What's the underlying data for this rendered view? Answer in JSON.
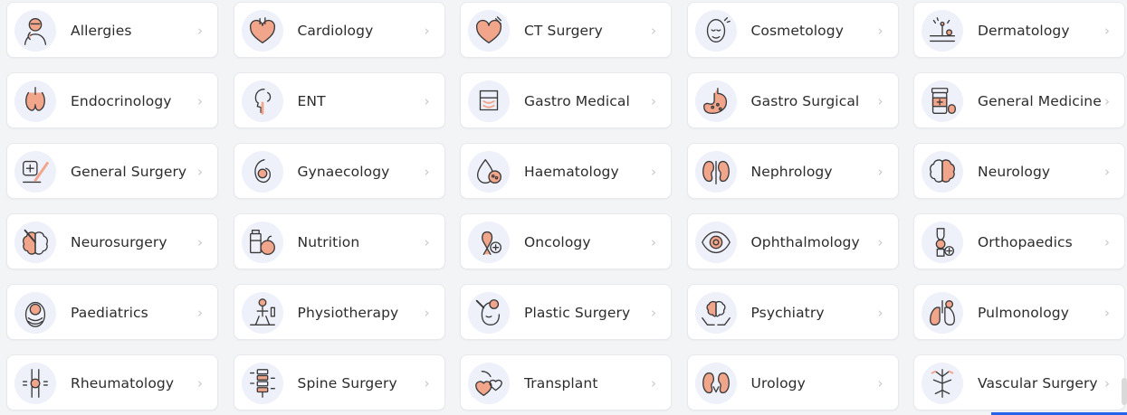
{
  "colors": {
    "icon_bg": "#eef0fa",
    "icon_stroke": "#3a3a3a",
    "icon_accent": "#f1a58b",
    "chevron": "#c4c7cf"
  },
  "chevron_glyph": "›",
  "specialties": [
    {
      "label": "Allergies",
      "icon": "allergy-person-icon"
    },
    {
      "label": "Cardiology",
      "icon": "heart-icon"
    },
    {
      "label": "CT Surgery",
      "icon": "heart-surgery-icon"
    },
    {
      "label": "Cosmetology",
      "icon": "face-care-icon"
    },
    {
      "label": "Dermatology",
      "icon": "skin-hair-icon"
    },
    {
      "label": "Endocrinology",
      "icon": "thyroid-icon"
    },
    {
      "label": "ENT",
      "icon": "ear-nose-throat-icon"
    },
    {
      "label": "Gastro Medical",
      "icon": "intestine-icon"
    },
    {
      "label": "Gastro Surgical",
      "icon": "stomach-icon"
    },
    {
      "label": "General Medicine",
      "icon": "medicine-bottle-icon"
    },
    {
      "label": "General Surgery",
      "icon": "scalpel-icon"
    },
    {
      "label": "Gynaecology",
      "icon": "womb-icon"
    },
    {
      "label": "Haematology",
      "icon": "blood-drop-icon"
    },
    {
      "label": "Nephrology",
      "icon": "kidneys-icon"
    },
    {
      "label": "Neurology",
      "icon": "brain-icon"
    },
    {
      "label": "Neurosurgery",
      "icon": "brain-surgery-icon"
    },
    {
      "label": "Nutrition",
      "icon": "nutrition-icon"
    },
    {
      "label": "Oncology",
      "icon": "cancer-ribbon-icon"
    },
    {
      "label": "Ophthalmology",
      "icon": "eye-icon"
    },
    {
      "label": "Orthopaedics",
      "icon": "bone-joint-icon"
    },
    {
      "label": "Paediatrics",
      "icon": "baby-icon"
    },
    {
      "label": "Physiotherapy",
      "icon": "physiotherapy-icon"
    },
    {
      "label": "Plastic Surgery",
      "icon": "plastic-surgery-face-icon"
    },
    {
      "label": "Psychiatry",
      "icon": "brain-hands-icon"
    },
    {
      "label": "Pulmonology",
      "icon": "lungs-icon"
    },
    {
      "label": "Rheumatology",
      "icon": "knee-joint-icon"
    },
    {
      "label": "Spine Surgery",
      "icon": "spine-icon"
    },
    {
      "label": "Transplant",
      "icon": "organ-transplant-icon"
    },
    {
      "label": "Urology",
      "icon": "urology-kidney-icon"
    },
    {
      "label": "Vascular Surgery",
      "icon": "blood-vessels-icon"
    }
  ]
}
